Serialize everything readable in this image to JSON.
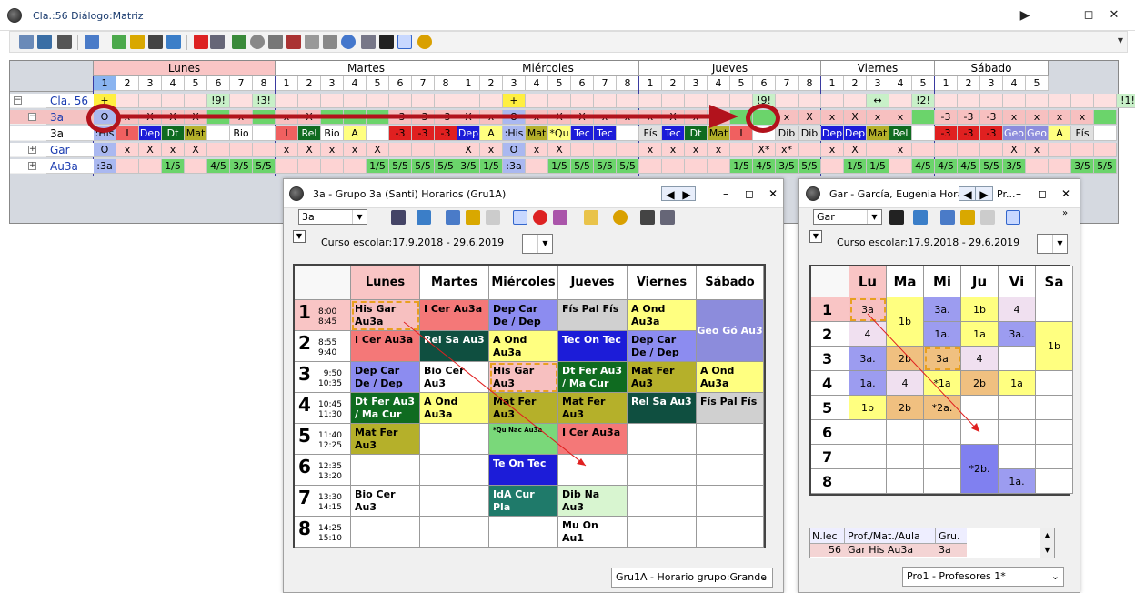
{
  "window": {
    "title": "Cla.:56  Diálogo:Matriz"
  },
  "matrix": {
    "days": [
      "Lunes",
      "Martes",
      "Miércoles",
      "Jueves",
      "Viernes",
      "Sábado"
    ],
    "periods_per_day": [
      8,
      8,
      8,
      8,
      5,
      5
    ],
    "rows": [
      {
        "label": "Cla. 56",
        "cells": [
          "+",
          "",
          "",
          "",
          "",
          "!9!",
          "",
          "!3!",
          "",
          "",
          "",
          "",
          "",
          "",
          "",
          "",
          "",
          "",
          "+",
          "",
          "",
          "",
          "",
          "",
          "",
          "",
          "",
          "",
          "",
          "!9!",
          "",
          "",
          "",
          "",
          "↔",
          "",
          "!2!",
          "",
          "",
          "",
          "",
          "",
          "",
          "",
          "",
          "!1!"
        ]
      },
      {
        "label": "3a",
        "cells": [
          "O",
          "x",
          "X",
          "X",
          "X",
          "",
          "x",
          "",
          "x",
          "X",
          "",
          "",
          "",
          "-3",
          "-3",
          "-3",
          "X",
          "x",
          "O",
          "x",
          "X",
          "X",
          "x",
          "x",
          "x",
          "X",
          "x",
          "x",
          "",
          "",
          "x",
          "X",
          "x",
          "X",
          "x",
          "x",
          "",
          "-3",
          "-3",
          "-3",
          "x",
          "x",
          "x",
          "x",
          ""
        ]
      },
      {
        "label": "3a",
        "cells": [
          ":His",
          "I",
          "Dep",
          "Dt",
          "Mat",
          "",
          "Bio",
          "",
          "I",
          "Rel",
          "Bio",
          "A",
          "",
          "-3",
          "-3",
          "-3",
          "Dep",
          "A",
          ":His",
          "Mat",
          "*Qu",
          "Tec",
          "Tec",
          "",
          "Fís",
          "Tec",
          "Dt",
          "Mat",
          "I",
          "",
          "Dib",
          "Dib",
          "Dep",
          "Dep",
          "Mat",
          "Rel",
          "",
          "-3",
          "-3",
          "-3",
          "Geo",
          "Geo",
          "A",
          "Fís",
          ""
        ]
      },
      {
        "label": "Gar",
        "cells": [
          "O",
          "x",
          "X",
          "x",
          "X",
          "",
          "",
          "",
          "x",
          "X",
          "x",
          "x",
          "X",
          "",
          "",
          "",
          "X",
          "x",
          "O",
          "x",
          "X",
          "",
          "",
          "",
          "x",
          "x",
          "x",
          "x",
          "",
          "X*",
          "x*",
          "",
          "x",
          "X",
          "",
          "x",
          "",
          "",
          "",
          "",
          "X",
          "x",
          "",
          "",
          ""
        ]
      },
      {
        "label": "Au3a",
        "cells": [
          ":3a",
          "",
          "",
          "1/5",
          "",
          "4/5",
          "3/5",
          "5/5",
          "",
          "",
          "",
          "",
          "1/5",
          "5/5",
          "5/5",
          "5/5",
          "3/5",
          "1/5",
          ":3a",
          "",
          "1/5",
          "5/5",
          "5/5",
          "5/5",
          "",
          "",
          "",
          "",
          "1/5",
          "4/5",
          "3/5",
          "5/5",
          "",
          "1/5",
          "1/5",
          "",
          "4/5",
          "4/5",
          "4/5",
          "5/5",
          "3/5",
          "",
          "",
          "3/5",
          "5/5"
        ]
      }
    ]
  },
  "left_window": {
    "title": "3a - Grupo 3a (Santi)  Horarios  (Gru1A)",
    "selector": "3a",
    "course": "Curso escolar:17.9.2018 - 29.6.2019",
    "days": [
      "Lunes",
      "Martes",
      "Miércoles",
      "Jueves",
      "Viernes",
      "Sábado"
    ],
    "periods": [
      {
        "n": "1",
        "t1": "8:00",
        "t2": "8:45"
      },
      {
        "n": "2",
        "t1": "8:55",
        "t2": "9:40"
      },
      {
        "n": "3",
        "t1": "9:50",
        "t2": "10:35"
      },
      {
        "n": "4",
        "t1": "10:45",
        "t2": "11:30"
      },
      {
        "n": "5",
        "t1": "11:40",
        "t2": "12:25"
      },
      {
        "n": "6",
        "t1": "12:35",
        "t2": "13:20"
      },
      {
        "n": "7",
        "t1": "13:30",
        "t2": "14:15"
      },
      {
        "n": "8",
        "t1": "14:25",
        "t2": "15:10"
      }
    ],
    "cells": [
      [
        "His Gar Au3a",
        "I Cer Au3a",
        "Dep Car De / Dep Gar De",
        "Fís Pal Fís",
        "A Ond Au3a",
        "Geo Gó Au3"
      ],
      [
        "I Cer Au3a",
        "Rel Sa Au3",
        "A Ond Au3a",
        "Tec On Tec",
        "Dep Car De / Dep Gar De",
        ""
      ],
      [
        "Dep Car De / Dep Gar De",
        "Bio Cer Au3",
        "His Gar Au3",
        "Dt Fer Au3 / Ma Cur Tec",
        "Mat Fer Au3",
        "A Ond Au3a"
      ],
      [
        "Dt Fer Au3 / Ma Cur Tec",
        "A Ond Au3a",
        "Mat Fer Au3",
        "Mat Fer Au3",
        "Rel Sa Au3",
        "Fís Pal Fís"
      ],
      [
        "Mat Fer Au3",
        "",
        "*Qu Nac Au3a",
        "I Cer Au3a",
        "",
        ""
      ],
      [
        "",
        "",
        "Te On Tec",
        "",
        "",
        ""
      ],
      [
        "Bio Cer Au3",
        "",
        "IdA Cur Pla",
        "Dib Na Au3",
        "",
        ""
      ],
      [
        "",
        "",
        "",
        "Mu On Au1",
        "",
        ""
      ]
    ],
    "footer": "Gru1A - Horario grupo:Grande"
  },
  "right_window": {
    "title": "Gar - García, Eugenia  Hora",
    "title_tail": "Pr...",
    "selector": "Gar",
    "course": "Curso escolar:17.9.2018 - 29.6.2019",
    "days": [
      "Lu",
      "Ma",
      "Mi",
      "Ju",
      "Vi",
      "Sa"
    ],
    "periods": [
      "1",
      "2",
      "3",
      "4",
      "5",
      "6",
      "7",
      "8"
    ],
    "cells": [
      [
        "3a",
        "1b",
        "3a.",
        "1b",
        "4",
        ""
      ],
      [
        "4",
        "",
        "1a.",
        "1a",
        "3a.",
        "1b"
      ],
      [
        "3a.",
        "2b",
        "3a",
        "4",
        "",
        ""
      ],
      [
        "1a.",
        "4",
        "*1a",
        "2b",
        "1a",
        ""
      ],
      [
        "1b",
        "2b",
        "*2a.",
        "",
        "",
        ""
      ],
      [
        "",
        "",
        "",
        "",
        "",
        ""
      ],
      [
        "",
        "",
        "",
        "*2b.",
        "",
        ""
      ],
      [
        "",
        "",
        "",
        "",
        "1a.",
        ""
      ]
    ],
    "table_headers": [
      "N.lec",
      "Prof./Mat./Aula",
      "Gru."
    ],
    "table_row": [
      "56",
      "Gar His Au3a",
      "3a"
    ],
    "footer": "Pro1 - Profesores 1*"
  },
  "colors": {
    "pink": "#f9c5c5",
    "green": "#6bd46b",
    "red": "#e02020",
    "blue": "#1c1cd8",
    "darkgreen": "#0f6b20",
    "olive": "#b5b02a",
    "yellow": "#ffff80",
    "purple": "#8c8cdc",
    "teal": "#1f7a6a",
    "accent": "#b2121c"
  }
}
